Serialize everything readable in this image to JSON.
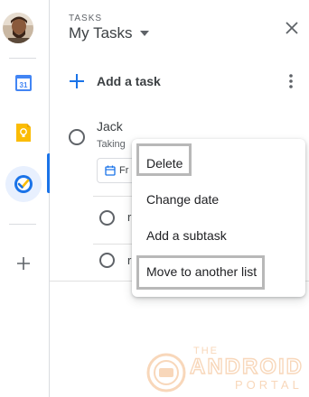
{
  "header": {
    "caption": "TASKS",
    "list_name": "My Tasks"
  },
  "sidebar": {
    "apps": [
      {
        "name": "Calendar",
        "badge": "31"
      },
      {
        "name": "Keep"
      },
      {
        "name": "Tasks",
        "active": true
      }
    ]
  },
  "add_task": {
    "label": "Add a task"
  },
  "task": {
    "title": "Jack",
    "notes": "Taking",
    "due_chip": "Fr",
    "subtasks": [
      {
        "text": "r"
      },
      {
        "text": "r"
      }
    ]
  },
  "context_menu": {
    "items": [
      {
        "label": "Delete",
        "highlighted": true
      },
      {
        "label": "Change date",
        "highlighted": false
      },
      {
        "label": "Add a subtask",
        "highlighted": false
      },
      {
        "label": "Move to another list",
        "highlighted": true
      }
    ]
  },
  "watermark": {
    "line1": "THE",
    "line2": "ANDROID",
    "line3": "PORTAL"
  },
  "colors": {
    "accent": "#1a73e8",
    "highlight_border": "#b8b8b8",
    "watermark": "#f0a868"
  }
}
